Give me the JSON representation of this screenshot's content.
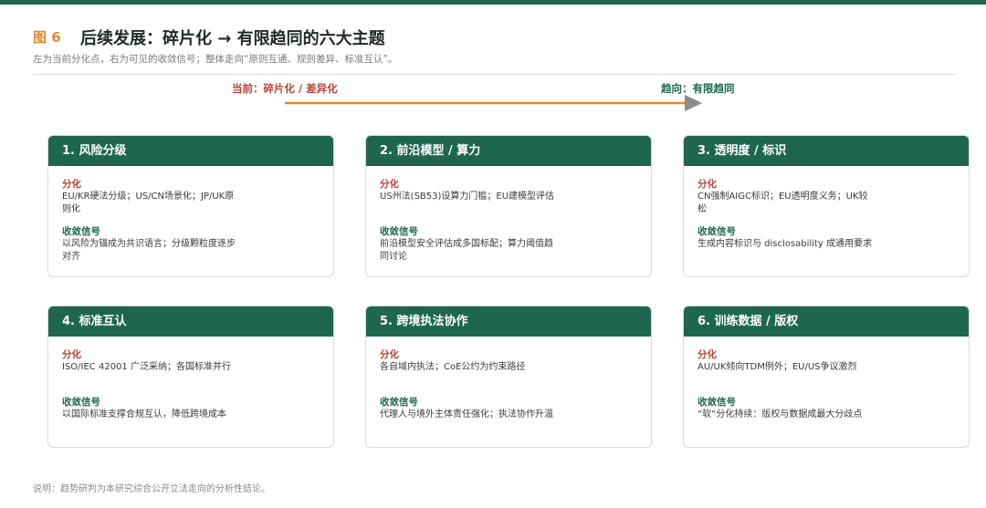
{
  "figure": {
    "label": "图 6",
    "title": "后续发展：碎片化 → 有限趋同的六大主题",
    "subtitle": "左为当前分化点，右为可见的收敛信号；整体走向“原则互通、规则差异、标准互认”。"
  },
  "axis": {
    "start_label": "当前：碎片化 / 差异化",
    "end_label": "趋向：有限趋同",
    "line_color": "#e0892d",
    "arrow_color": "#8c8c8c"
  },
  "section_labels": {
    "divergence": "分化",
    "convergence": "收敛信号"
  },
  "cards": [
    {
      "title": "1. 风险分级",
      "divergence": "EU/KR硬法分级；US/CN场景化；JP/UK原则化",
      "convergence": "以风险为锚成为共识语言；分级颗粒度逐步对齐"
    },
    {
      "title": "2. 前沿模型 / 算力",
      "divergence": "US州法(SB53)设算力门槛；EU建模型评估",
      "convergence": "前沿模型安全评估成多国标配；算力阈值趋同讨论"
    },
    {
      "title": "3. 透明度 / 标识",
      "divergence": "CN强制AIGC标识；EU透明度义务；UK较松",
      "convergence": "生成内容标识与 disclosability 成通用要求"
    },
    {
      "title": "4. 标准互认",
      "divergence": "ISO/IEC 42001 广泛采纳；各国标准并行",
      "convergence": "以国际标准支撑合规互认，降低跨境成本"
    },
    {
      "title": "5. 跨境执法协作",
      "divergence": "各自域内执法；CoE公约为约束路径",
      "convergence": "代理人与境外主体责任强化；执法协作升温"
    },
    {
      "title": "6. 训练数据 / 版权",
      "divergence": "AU/UK倾向TDM例外；EU/US争议激烈",
      "convergence": "“软”分化持续：版权与数据成最大分歧点"
    }
  ],
  "footnote": "说明：趋势研判为本研究综合公开立法走向的分析性结论。",
  "colors": {
    "brand_green": "#1e6650",
    "accent_orange": "#e0892d",
    "divergence_red": "#b84335"
  }
}
